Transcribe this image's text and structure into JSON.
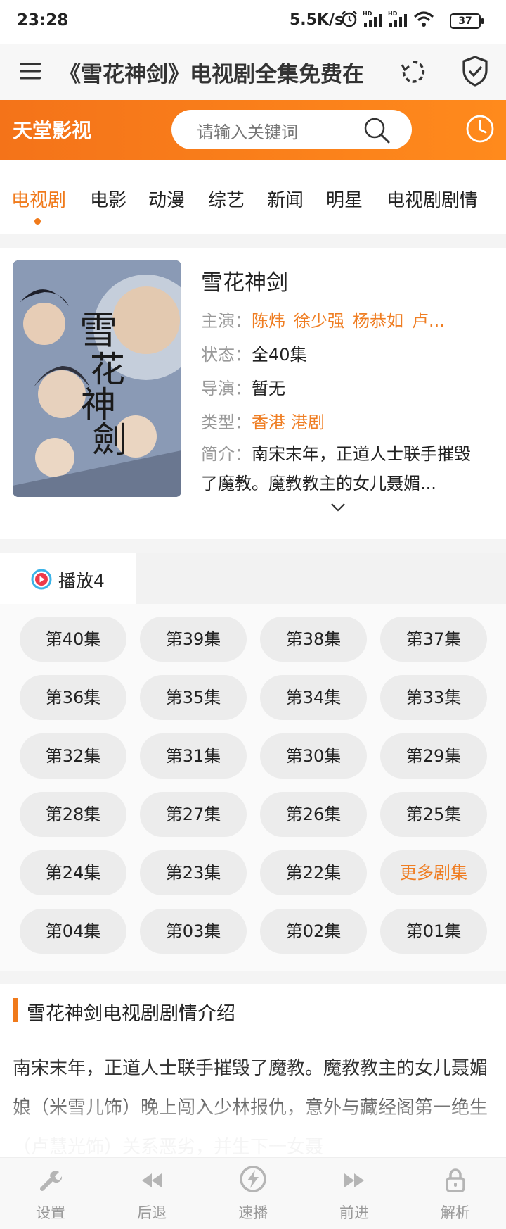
{
  "status_bar": {
    "time": "23:28",
    "speed": "5.5K/s",
    "battery": "37"
  },
  "title_bar": {
    "title": "《雪花神剑》电视剧全集免费在"
  },
  "header": {
    "brand": "天堂影视",
    "search_placeholder": "请输入关键词",
    "accent_color": "#f47319"
  },
  "tabs": [
    {
      "label": "电视剧",
      "active": true
    },
    {
      "label": "电影",
      "active": false
    },
    {
      "label": "动漫",
      "active": false
    },
    {
      "label": "综艺",
      "active": false
    },
    {
      "label": "新闻",
      "active": false
    },
    {
      "label": "明星",
      "active": false
    },
    {
      "label": "电视剧剧情",
      "active": false
    }
  ],
  "detail": {
    "title": "雪花神剑",
    "poster_title": "雪花神剑",
    "cast_label": "主演：",
    "cast": [
      "陈炜",
      "徐少强",
      "杨恭如",
      "卢..."
    ],
    "status_label": "状态：",
    "status": "全40集",
    "director_label": "导演：",
    "director": "暂无",
    "genre_label": "类型：",
    "genres": [
      "香港",
      "港剧"
    ],
    "intro_label": "简介：",
    "intro": "南宋末年，正道人士联手摧毁了魔教。魔教教主的女儿聂媚..."
  },
  "source": {
    "label": "播放4"
  },
  "episodes": [
    "第40集",
    "第39集",
    "第38集",
    "第37集",
    "第36集",
    "第35集",
    "第34集",
    "第33集",
    "第32集",
    "第31集",
    "第30集",
    "第29集",
    "第28集",
    "第27集",
    "第26集",
    "第25集",
    "第24集",
    "第23集",
    "第22集",
    "更多剧集",
    "第04集",
    "第03集",
    "第02集",
    "第01集"
  ],
  "plot": {
    "title": "雪花神剑电视剧剧情介绍",
    "text": "南宋末年，正道人士联手摧毁了魔教。魔教教主的女儿聂媚娘（米雪儿饰）晚上闯入少林报仇，意外与藏经阁第一绝生（卢慧光饰）关系恶劣，并生下一女聂"
  },
  "bottom_nav": [
    {
      "label": "设置",
      "icon": "wrench-icon"
    },
    {
      "label": "后退",
      "icon": "rewind-icon"
    },
    {
      "label": "速播",
      "icon": "lightning-icon"
    },
    {
      "label": "前进",
      "icon": "fast-forward-icon"
    },
    {
      "label": "解析",
      "icon": "lock-icon"
    }
  ]
}
